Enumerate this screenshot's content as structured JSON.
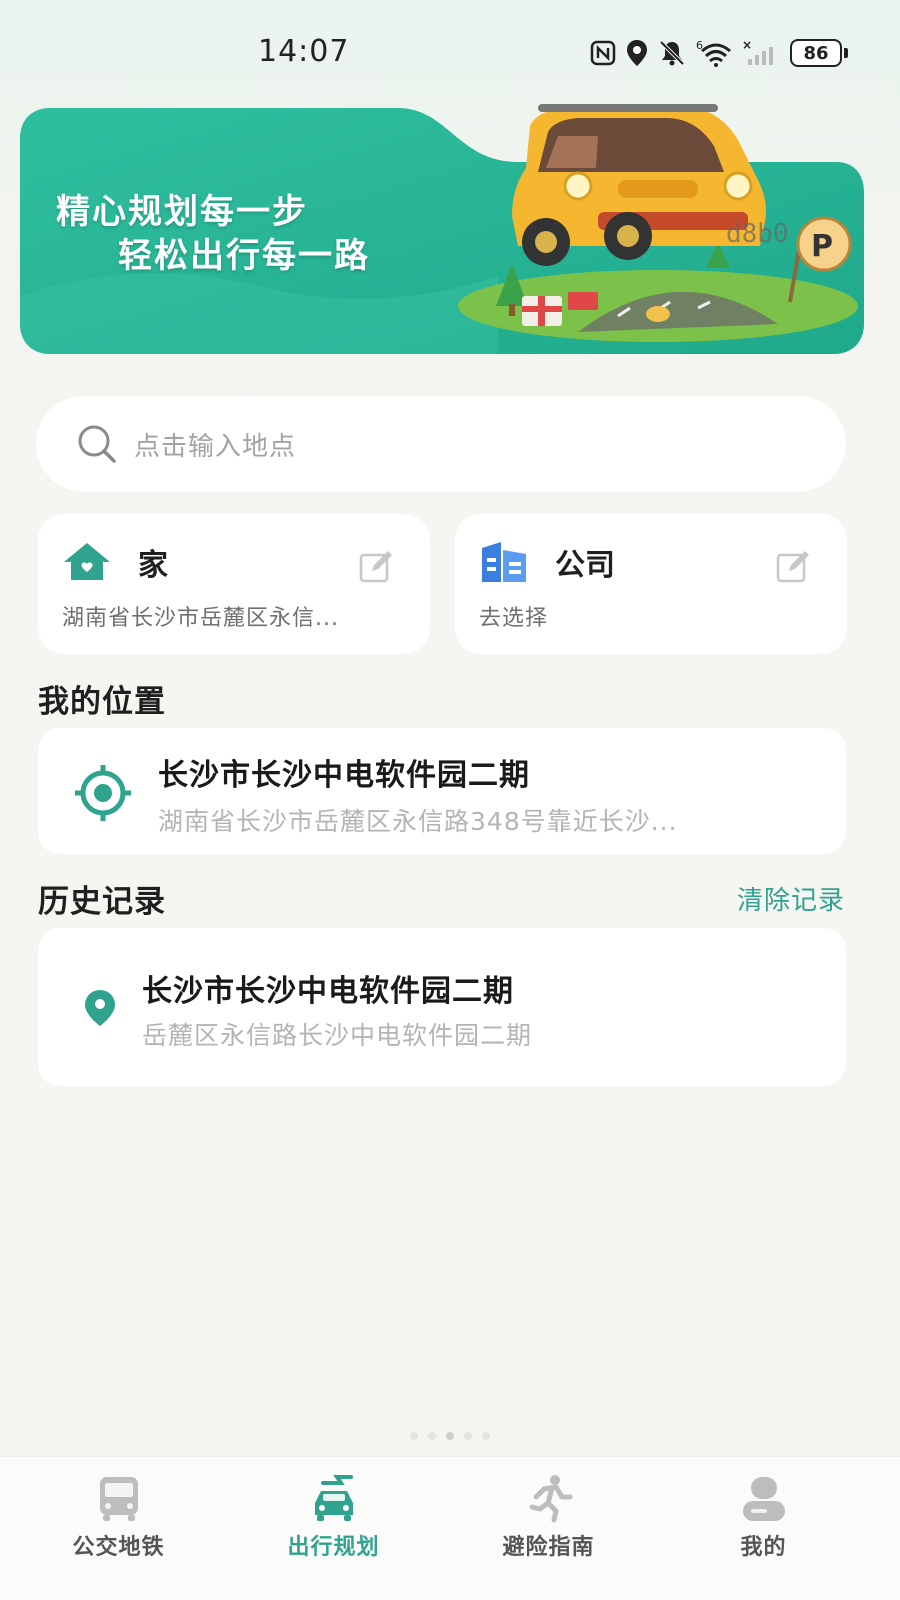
{
  "status_bar": {
    "time": "14:07",
    "battery": "86",
    "icons": [
      "nfc-icon",
      "location-icon",
      "mute-icon",
      "wifi-icon",
      "signal-icon",
      "battery-icon"
    ]
  },
  "banner": {
    "line1": "精心规划每一步",
    "line2": "轻松出行每一路",
    "watermark": "d8b0"
  },
  "search": {
    "placeholder": "点击输入地点"
  },
  "quick_places": {
    "home": {
      "label": "家",
      "address": "湖南省长沙市岳麓区永信..."
    },
    "company": {
      "label": "公司",
      "address": "去选择"
    }
  },
  "my_location": {
    "heading": "我的位置",
    "title": "长沙市长沙中电软件园二期",
    "address": "湖南省长沙市岳麓区永信路348号靠近长沙..."
  },
  "history": {
    "heading": "历史记录",
    "clear_label": "清除记录",
    "items": [
      {
        "title": "长沙市长沙中电软件园二期",
        "address": "岳麓区永信路长沙中电软件园二期"
      }
    ]
  },
  "nav": {
    "items": [
      {
        "label": "公交地铁",
        "icon": "bus-icon",
        "active": false
      },
      {
        "label": "出行规划",
        "icon": "car-plan-icon",
        "active": true
      },
      {
        "label": "避险指南",
        "icon": "running-person-icon",
        "active": false
      },
      {
        "label": "我的",
        "icon": "profile-icon",
        "active": false
      }
    ]
  },
  "colors": {
    "accent": "#2fa38e",
    "banner": "#27b99a",
    "home_icon": "#2fa38e",
    "company_icon": "#3a7fe0"
  }
}
